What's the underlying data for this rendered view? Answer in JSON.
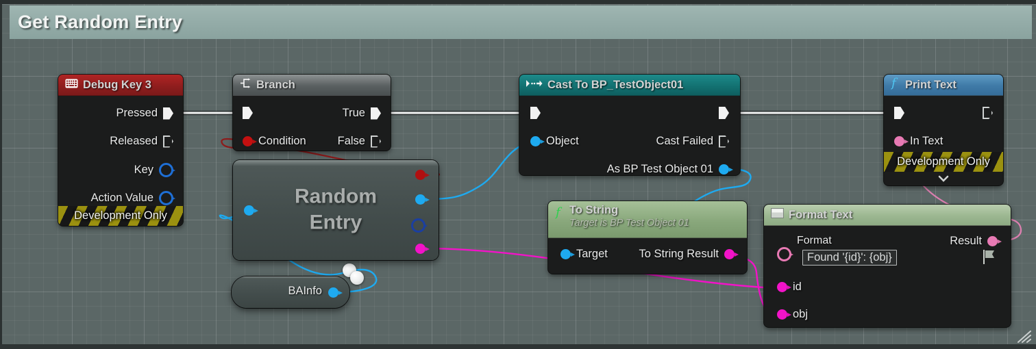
{
  "window": {
    "title": "Get Random Entry",
    "title_bar_color": "#93aba7",
    "canvas_color": "#5b6766"
  },
  "nodes": [
    {
      "id": "debug-key-3",
      "title": "Debug Key 3",
      "icon": "keyboard-icon",
      "header_color": "#8d1d1d",
      "footer": "Development Only",
      "pins": [
        {
          "name": "Pressed",
          "kind": "exec",
          "side": "out",
          "filled": true
        },
        {
          "name": "Released",
          "kind": "exec",
          "side": "out",
          "filled": false
        },
        {
          "name": "Key",
          "kind": "data",
          "side": "out",
          "color": "#1e6fd6",
          "ring": true
        },
        {
          "name": "Action Value",
          "kind": "data",
          "side": "out",
          "color": "#1e6fd6",
          "ring": true
        }
      ]
    },
    {
      "id": "branch",
      "title": "Branch",
      "icon": "branch-icon",
      "header_color": "#5a6061",
      "pins": [
        {
          "name": "",
          "kind": "exec",
          "side": "in",
          "filled": true
        },
        {
          "name": "True",
          "kind": "exec",
          "side": "out",
          "filled": true
        },
        {
          "name": "Condition",
          "kind": "data",
          "side": "in",
          "color": "#c41010"
        },
        {
          "name": "False",
          "kind": "exec",
          "side": "out",
          "filled": false
        }
      ]
    },
    {
      "id": "random-entry",
      "title": "Random Entry",
      "collapsed": true,
      "pins": [
        {
          "name": "",
          "kind": "data",
          "side": "in",
          "color": "#1eaaf0"
        },
        {
          "name": "",
          "kind": "data",
          "side": "out",
          "color": "#b01010"
        },
        {
          "name": "",
          "kind": "data",
          "side": "out",
          "color": "#1eaaf0"
        },
        {
          "name": "",
          "kind": "data",
          "side": "out",
          "color": "#1b3fa0",
          "ring": true
        },
        {
          "name": "",
          "kind": "data",
          "side": "out",
          "color": "#f213c8"
        }
      ]
    },
    {
      "id": "bainfo",
      "title": "BAInfo",
      "collapsed": true,
      "pins": [
        {
          "name": "BAInfo",
          "kind": "data",
          "side": "out",
          "color": "#1eaaf0"
        }
      ]
    },
    {
      "id": "cast-to-bp-testobject01",
      "title": "Cast To BP_TestObject01",
      "icon": "cast-icon",
      "header_color": "#137272",
      "pins": [
        {
          "name": "",
          "kind": "exec",
          "side": "in",
          "filled": true
        },
        {
          "name": "",
          "kind": "exec",
          "side": "out",
          "filled": true
        },
        {
          "name": "Object",
          "kind": "data",
          "side": "in",
          "color": "#1eaaf0"
        },
        {
          "name": "Cast Failed",
          "kind": "exec",
          "side": "out",
          "filled": false
        },
        {
          "name": "As BP Test Object 01",
          "kind": "data",
          "side": "out",
          "color": "#1eaaf0"
        }
      ]
    },
    {
      "id": "to-string",
      "title": "To String",
      "subtitle": "Target is BP Test Object 01",
      "icon": "function-icon",
      "header_color": "#89a87c",
      "pins": [
        {
          "name": "Target",
          "kind": "data",
          "side": "in",
          "color": "#1eaaf0"
        },
        {
          "name": "To String Result",
          "kind": "data",
          "side": "out",
          "color": "#f213c8"
        }
      ]
    },
    {
      "id": "format-text",
      "title": "Format Text",
      "icon": "text-icon",
      "header_color": "#9cb791",
      "format_label": "Format",
      "format_value": "Found '{id}': {obj}",
      "flag_icon": "localization-flag-icon",
      "pins": [
        {
          "name": "",
          "kind": "data",
          "side": "in",
          "color": "#e87ab4",
          "ring": true
        },
        {
          "name": "Result",
          "kind": "data",
          "side": "out",
          "color": "#e87ab4"
        },
        {
          "name": "id",
          "kind": "data",
          "side": "in",
          "color": "#f213c8"
        },
        {
          "name": "obj",
          "kind": "data",
          "side": "in",
          "color": "#f213c8"
        }
      ]
    },
    {
      "id": "print-text",
      "title": "Print Text",
      "icon": "function-icon",
      "header_color": "#3f7aa7",
      "footer": "Development Only",
      "expander": "chevron-down-icon",
      "pins": [
        {
          "name": "",
          "kind": "exec",
          "side": "in",
          "filled": true
        },
        {
          "name": "",
          "kind": "exec",
          "side": "out",
          "filled": false
        },
        {
          "name": "In Text",
          "kind": "data",
          "side": "in",
          "color": "#e87ab4"
        }
      ]
    }
  ],
  "labels": {
    "debug_key_title": "Debug Key 3",
    "debug_pressed": "Pressed",
    "debug_released": "Released",
    "debug_key": "Key",
    "debug_action_value": "Action Value",
    "debug_dev_only": "Development Only",
    "branch_title": "Branch",
    "branch_true": "True",
    "branch_false": "False",
    "branch_condition": "Condition",
    "random_entry_line1": "Random",
    "random_entry_line2": "Entry",
    "bainfo": "BAInfo",
    "cast_title": "Cast To BP_TestObject01",
    "cast_object": "Object",
    "cast_failed": "Cast Failed",
    "cast_as": "As BP Test Object 01",
    "tostring_title": "To String",
    "tostring_sub": "Target is BP Test Object 01",
    "tostring_target": "Target",
    "tostring_result": "To String Result",
    "formattext_title": "Format Text",
    "formattext_format": "Format",
    "formattext_value": "Found '{id}': {obj}",
    "formattext_result": "Result",
    "formattext_id": "id",
    "formattext_obj": "obj",
    "printtext_title": "Print Text",
    "printtext_intext": "In Text",
    "printtext_dev_only": "Development Only"
  },
  "wires": [
    {
      "from": "debug-key-3.Pressed",
      "to": "branch.exec-in",
      "color": "#ffffff",
      "type": "exec"
    },
    {
      "from": "branch.True",
      "to": "cast-to-bp-testobject01.exec-in",
      "color": "#ffffff",
      "type": "exec"
    },
    {
      "from": "cast-to-bp-testobject01.exec-out",
      "to": "print-text.exec-in",
      "color": "#ffffff",
      "type": "exec"
    },
    {
      "from": "branch.Condition",
      "to": "random-entry.out-bool",
      "color": "#8b1818",
      "type": "data"
    },
    {
      "from": "random-entry.out-object",
      "to": "cast-to-bp-testobject01.Object",
      "color": "#1eaaf0",
      "type": "data"
    },
    {
      "from": "random-entry.out-magenta",
      "to": "format-text.id",
      "color": "#f213c8",
      "type": "data"
    },
    {
      "from": "bainfo.out",
      "to": "random-entry.in",
      "color": "#1eaaf0",
      "type": "data"
    },
    {
      "from": "cast-to-bp-testobject01.As BP Test Object 01",
      "to": "to-string.Target",
      "color": "#1eaaf0",
      "type": "data"
    },
    {
      "from": "to-string.To String Result",
      "to": "format-text.obj",
      "color": "#f213c8",
      "type": "data"
    },
    {
      "from": "format-text.Result",
      "to": "print-text.In Text",
      "color": "#e87ab4",
      "type": "data"
    }
  ],
  "misc": {
    "resize_grip": "resize-grip-icon"
  }
}
